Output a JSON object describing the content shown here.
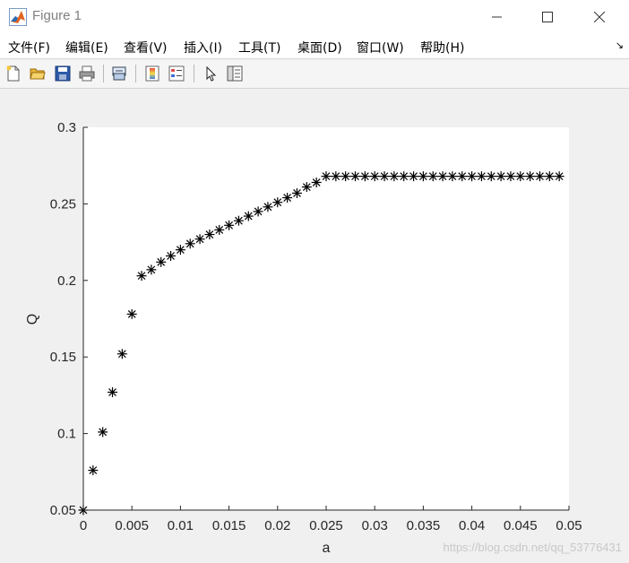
{
  "window": {
    "title": "Figure 1",
    "icon": "matlab-icon",
    "controls": {
      "minimize": "minimize-icon",
      "maximize": "maximize-icon",
      "close": "close-icon"
    }
  },
  "menu": {
    "items": [
      {
        "label": "文件(F)"
      },
      {
        "label": "编辑(E)"
      },
      {
        "label": "查看(V)"
      },
      {
        "label": "插入(I)"
      },
      {
        "label": "工具(T)"
      },
      {
        "label": "桌面(D)"
      },
      {
        "label": "窗口(W)"
      },
      {
        "label": "帮助(H)"
      }
    ],
    "dock_arrow": "↘"
  },
  "toolbar": {
    "buttons": [
      "new-figure-icon",
      "open-file-icon",
      "save-icon",
      "print-icon",
      "link-icon",
      "colorbar-icon",
      "legend-icon",
      "pointer-icon",
      "property-editor-icon"
    ]
  },
  "chart_data": {
    "type": "scatter",
    "marker": "*",
    "marker_color": "#000000",
    "title": "",
    "xlabel": "a",
    "ylabel": "Q",
    "xlim": [
      0,
      0.05
    ],
    "ylim": [
      0.05,
      0.3
    ],
    "xticks": [
      "0",
      "0.005",
      "0.01",
      "0.015",
      "0.02",
      "0.025",
      "0.03",
      "0.035",
      "0.04",
      "0.045",
      "0.05"
    ],
    "yticks": [
      "0.05",
      "0.1",
      "0.15",
      "0.2",
      "0.25",
      "0.3"
    ],
    "grid": false,
    "series": [
      {
        "x": [
          0,
          0.001,
          0.002,
          0.003,
          0.004,
          0.005,
          0.006,
          0.007,
          0.008,
          0.009,
          0.01,
          0.011,
          0.012,
          0.013,
          0.014,
          0.015,
          0.016,
          0.017,
          0.018,
          0.019,
          0.02,
          0.021,
          0.022,
          0.023,
          0.024,
          0.025,
          0.026,
          0.027,
          0.028,
          0.029,
          0.03,
          0.031,
          0.032,
          0.033,
          0.034,
          0.035,
          0.036,
          0.037,
          0.038,
          0.039,
          0.04,
          0.041,
          0.042,
          0.043,
          0.044,
          0.045,
          0.046,
          0.047,
          0.048,
          0.049
        ],
        "y": [
          0.05,
          0.076,
          0.101,
          0.127,
          0.152,
          0.178,
          0.203,
          0.207,
          0.212,
          0.216,
          0.22,
          0.224,
          0.227,
          0.23,
          0.233,
          0.236,
          0.239,
          0.242,
          0.245,
          0.248,
          0.251,
          0.254,
          0.257,
          0.261,
          0.264,
          0.268,
          0.268,
          0.268,
          0.268,
          0.268,
          0.268,
          0.268,
          0.268,
          0.268,
          0.268,
          0.268,
          0.268,
          0.268,
          0.268,
          0.268,
          0.268,
          0.268,
          0.268,
          0.268,
          0.268,
          0.268,
          0.268,
          0.268,
          0.268,
          0.268
        ]
      }
    ]
  },
  "watermark": "https://blog.csdn.net/qq_53776431"
}
